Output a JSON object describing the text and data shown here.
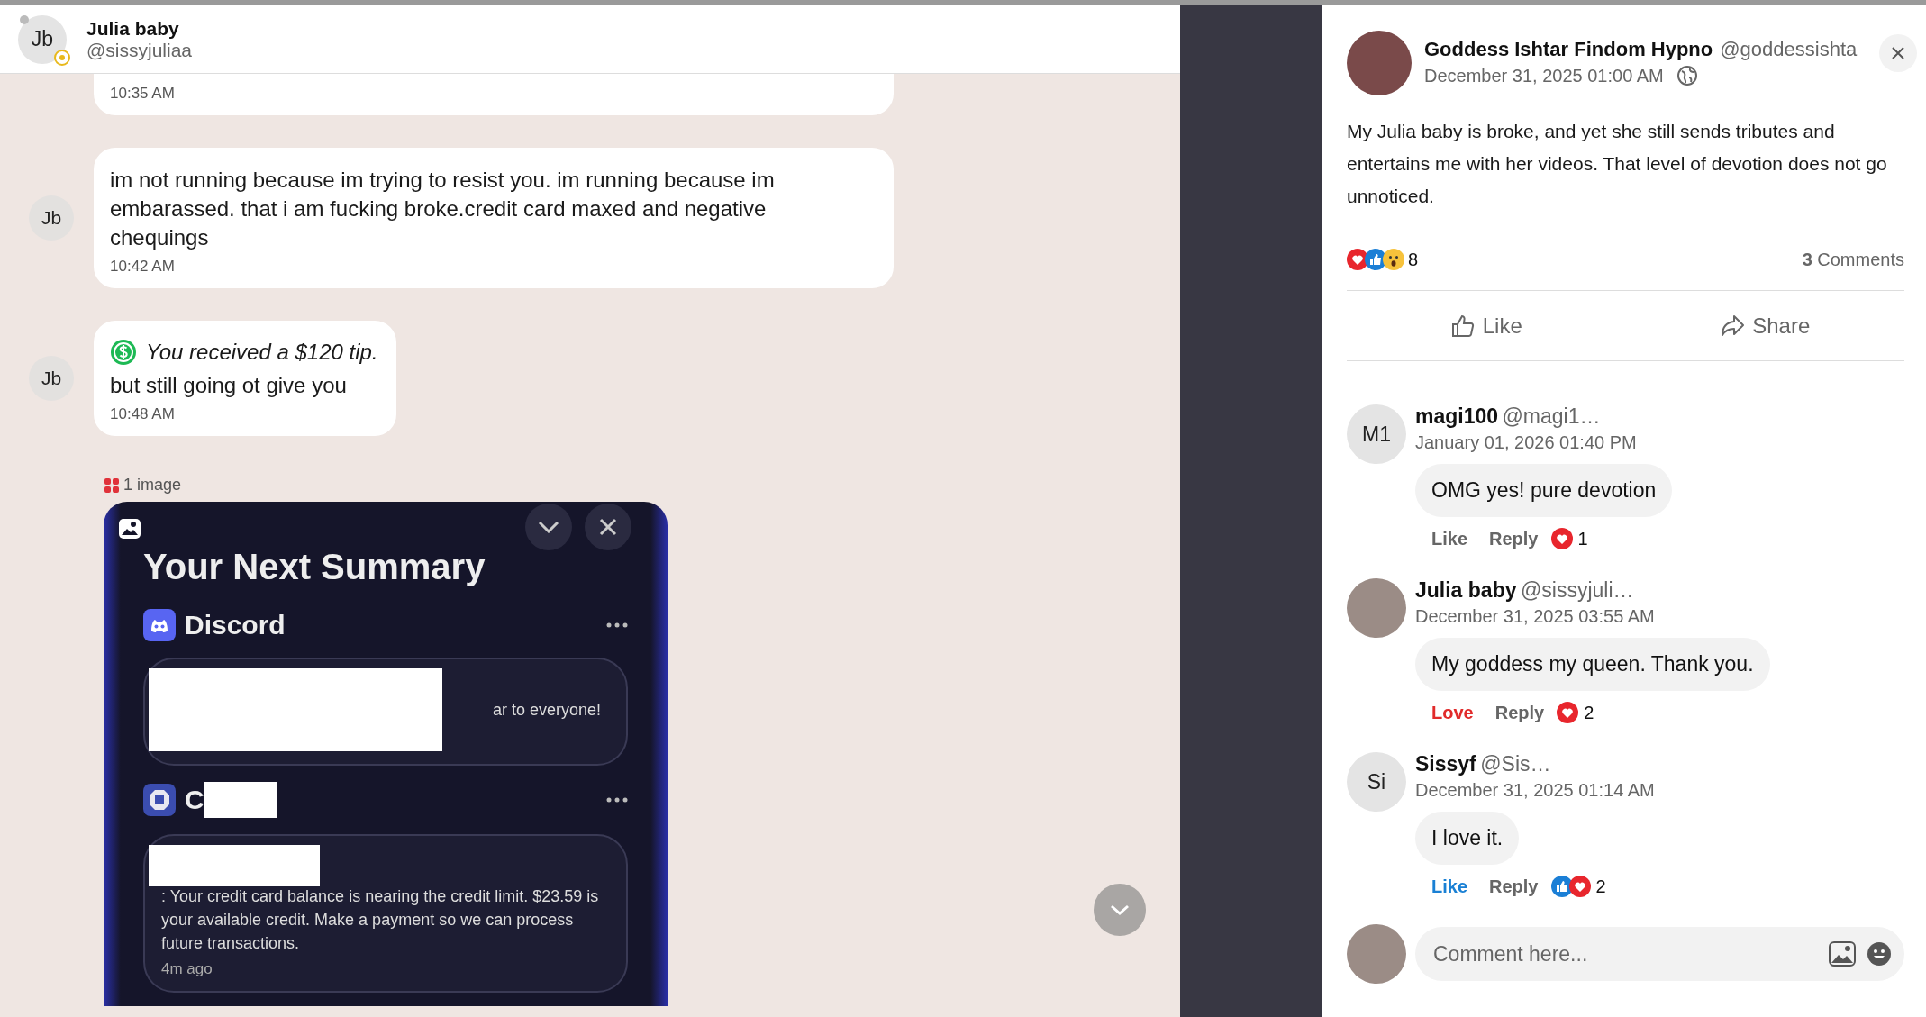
{
  "chat": {
    "header": {
      "initials": "Jb",
      "name": "Julia baby",
      "handle": "@sissyjuliaa",
      "online": false
    },
    "messages": [
      {
        "kind": "text",
        "time": "10:35 AM"
      },
      {
        "kind": "text",
        "initials": "Jb",
        "text": "im not running because im trying to resist you. im running because im embarassed. that i am fucking broke.credit card maxed and negative chequings",
        "time": "10:42 AM"
      },
      {
        "kind": "tip",
        "initials": "Jb",
        "tip": "You received a $120 tip.",
        "text": "but still going ot give you",
        "time": "10:48 AM"
      }
    ],
    "attachment": {
      "label": "1 image",
      "screenshot": {
        "title": "Your Next Summary",
        "groups": [
          {
            "kind": "chat_app",
            "app": "Discord",
            "redacted_title": false,
            "text": "ar to everyone!"
          },
          {
            "kind": "bank",
            "app": "C",
            "redacted_title": true,
            "text": ": Your credit card balance is nearing the credit limit. $23.59 is your available credit. Make a payment so we can process future transactions.",
            "time": "4m ago"
          }
        ]
      }
    }
  },
  "post": {
    "author": "Goddess Ishtar Findom Hypno",
    "handle": "@goddessishta",
    "date": "December 31, 2025 01:00 AM",
    "body": "My Julia baby is broke, and yet she still sends tributes and entertains me with her videos. That level of devotion does not go unnoticed.",
    "reactions": [
      {
        "kind": "love"
      },
      {
        "kind": "like"
      },
      {
        "kind": "wow"
      }
    ],
    "reaction_count": "8",
    "comments_count": "**3** Comments",
    "actions": [
      {
        "kind": "like",
        "label": "Like"
      },
      {
        "kind": "share",
        "label": "Share"
      }
    ],
    "comments": [
      {
        "initials": "M1",
        "photo": false,
        "name": "magi100",
        "handle": "@magi1…",
        "date": "January 01, 2026 01:40 PM",
        "text": "OMG yes! pure devotion",
        "action": {
          "kind": "plain",
          "label": "Like"
        },
        "reply": "Reply",
        "reactions": [
          {
            "kind": "love"
          }
        ],
        "count": "1"
      },
      {
        "photo": true,
        "name": "Julia baby",
        "handle": "@sissyjuli…",
        "date": "December 31, 2025 03:55 AM",
        "text": "My goddess my queen. Thank you.",
        "action": {
          "kind": "love",
          "label": "Love"
        },
        "reply": "Reply",
        "reactions": [
          {
            "kind": "love"
          }
        ],
        "count": "2"
      },
      {
        "initials": "Si",
        "photo": false,
        "name": "Sissyf",
        "handle": "@Sis…",
        "date": "December 31, 2025 01:14 AM",
        "text": "I love it.",
        "action": {
          "kind": "like",
          "label": "Like"
        },
        "reply": "Reply",
        "reactions": [
          {
            "kind": "like"
          },
          {
            "kind": "love"
          }
        ],
        "count": "2"
      }
    ],
    "composer": {
      "placeholder": "Comment here..."
    }
  }
}
